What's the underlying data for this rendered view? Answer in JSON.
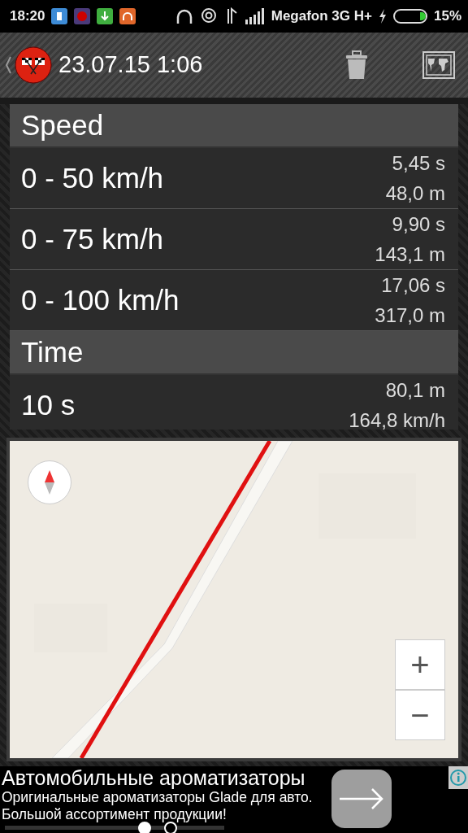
{
  "status_bar": {
    "time": "18:20",
    "carrier": "Megafon 3G H+",
    "battery": "15%"
  },
  "toolbar": {
    "title": "23.07.15 1:06"
  },
  "sections": [
    {
      "title": "Speed",
      "rows": [
        {
          "label": "0 - 50 km/h",
          "value_1": "5,45 s",
          "value_2": "48,0 m"
        },
        {
          "label": "0 - 75 km/h",
          "value_1": "9,90 s",
          "value_2": "143,1 m"
        },
        {
          "label": "0 - 100 km/h",
          "value_1": "17,06 s",
          "value_2": "317,0 m"
        }
      ]
    },
    {
      "title": "Time",
      "rows": [
        {
          "label": "10 s",
          "value_1": "80,1 m",
          "value_2": "164,8 km/h"
        }
      ]
    }
  ],
  "map": {
    "zoom_in": "+",
    "zoom_out": "−"
  },
  "ad": {
    "title": "Автомобильные ароматизаторы",
    "lines": [
      "Оригинальные ароматизаторы Glade для авто.",
      "Большой ассортимент продукции!"
    ]
  },
  "pager": [
    {
      "selected": true
    },
    {
      "selected": false
    }
  ]
}
